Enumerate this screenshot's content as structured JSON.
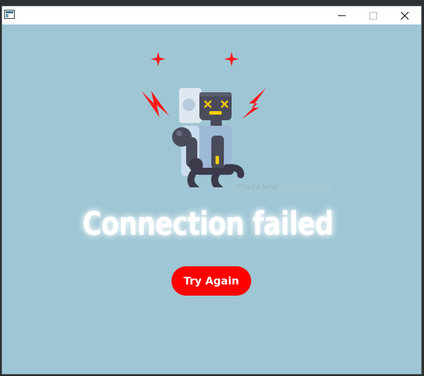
{
  "window": {
    "title": "",
    "icon": "app-window-icon",
    "controls": {
      "minimize_icon": "minimize-icon",
      "maximize_icon": "maximize-icon",
      "close_icon": "close-icon"
    }
  },
  "main": {
    "heading": "Connection failed",
    "retry_button": "Try Again",
    "faint_label": "rmgdsl Smp"
  },
  "colors": {
    "background": "#9ec6d4",
    "accent": "#ff0000",
    "text": "#ffffff"
  },
  "illustration": {
    "name": "broken-robot-illustration"
  }
}
